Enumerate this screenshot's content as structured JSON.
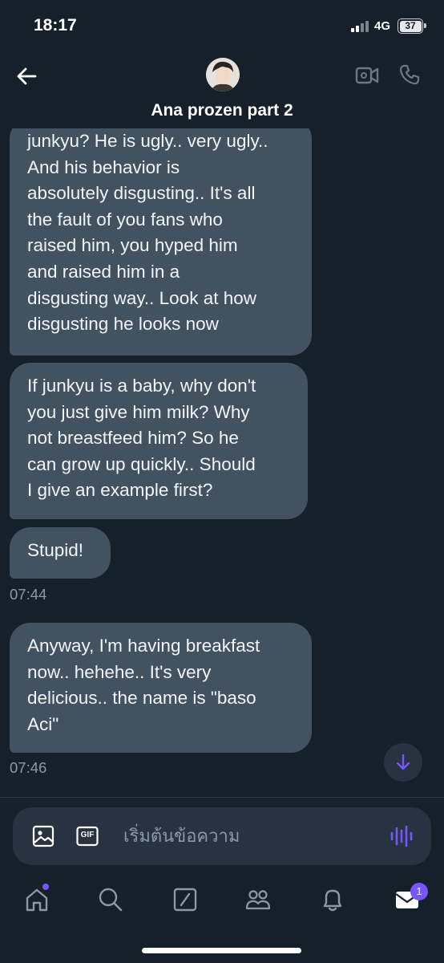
{
  "status_bar": {
    "time": "18:17",
    "network": "4G",
    "battery": "37"
  },
  "header": {
    "title": "Ana prozen part 2"
  },
  "messages": [
    {
      "text": "junkyu? He is ugly.. very ugly..\nAnd his behavior is\nabsolutely disgusting.. It's all\nthe fault of you fans who\nraised him, you hyped him\nand raised him in a\ndisgusting way.. Look at how\ndisgusting he looks now"
    },
    {
      "text": "If junkyu is a baby, why don't\nyou just give him milk? Why\nnot breastfeed him? So he\ncan grow up quickly.. Should\nI give an example first?"
    },
    {
      "text": "Stupid!",
      "time": "07:44"
    },
    {
      "text": "Anyway, I'm having breakfast\nnow.. hehehe.. It's very\ndelicious.. the name is \"baso\nAci\"",
      "time": "07:46"
    }
  ],
  "composer": {
    "placeholder": "เริ่มต้นข้อความ",
    "gif_label": "GIF"
  },
  "tabbar": {
    "messages_badge": "1"
  },
  "icons": {
    "back": "arrow-left-icon",
    "video": "video-camera-icon",
    "call": "phone-icon",
    "media": "image-icon",
    "gif": "gif-icon",
    "voice": "waveform-icon",
    "home": "home-icon",
    "search": "search-icon",
    "grok": "grok-icon",
    "communities": "communities-icon",
    "notifications": "bell-icon",
    "messages": "envelope-icon",
    "scroll": "arrow-down-icon"
  },
  "colors": {
    "background": "#15202b",
    "bubble": "#435261",
    "accent": "#7856ff",
    "muted": "#8b98a5"
  }
}
